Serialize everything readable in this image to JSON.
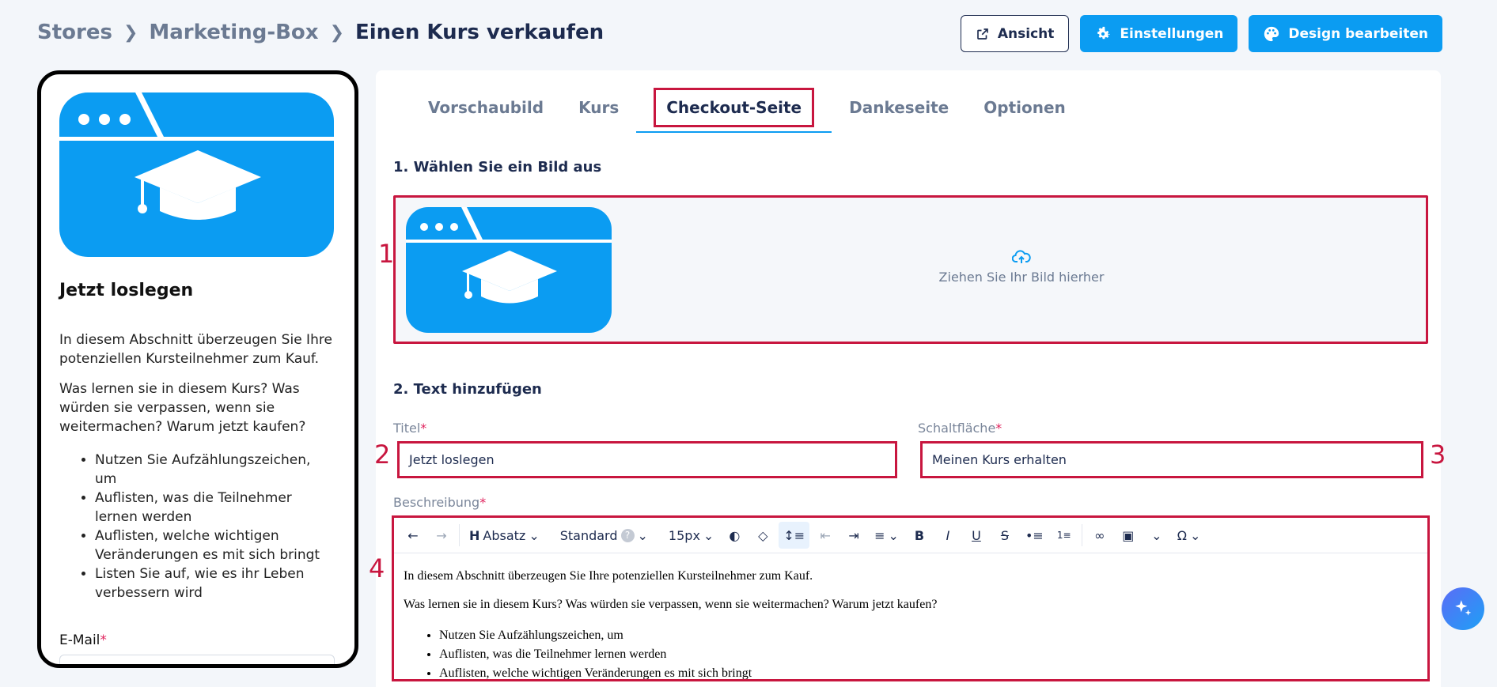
{
  "breadcrumb": {
    "items": [
      "Stores",
      "Marketing-Box",
      "Einen Kurs verkaufen"
    ],
    "separator": ">"
  },
  "actions": {
    "view_label": "Ansicht",
    "settings_label": "Einstellungen",
    "design_label": "Design bearbeiten"
  },
  "preview": {
    "title": "Jetzt loslegen",
    "paragraphs": [
      "In diesem Abschnitt überzeugen Sie Ihre potenziellen Kursteilnehmer zum Kauf.",
      "Was lernen sie in diesem Kurs? Was würden sie verpassen, wenn sie weitermachen? Warum jetzt kaufen?"
    ],
    "bullets": [
      "Nutzen Sie Aufzählungszeichen, um",
      "Auflisten, was die Teilnehmer lernen werden",
      "Auflisten, welche wichtigen Veränderungen es mit sich bringt",
      "Listen Sie auf, wie es ihr Leben verbessern wird"
    ],
    "email_label": "E-Mail",
    "required_mark": "*"
  },
  "tabs": [
    {
      "label": "Vorschaubild"
    },
    {
      "label": "Kurs"
    },
    {
      "label": "Checkout-Seite",
      "active": true
    },
    {
      "label": "Dankeseite"
    },
    {
      "label": "Optionen"
    }
  ],
  "section1": {
    "title": "1. Wählen Sie ein Bild aus",
    "drop_text": "Ziehen Sie Ihr Bild hierher"
  },
  "section2": {
    "title": "2. Text hinzufügen",
    "title_label": "Titel",
    "title_value": "Jetzt loslegen",
    "button_label": "Schaltfläche",
    "button_value": "Meinen Kurs erhalten",
    "description_label": "Beschreibung"
  },
  "editor": {
    "heading_select": "Absatz",
    "style_select": "Standard",
    "size_select": "15px",
    "body_paragraphs": [
      "In diesem Abschnitt überzeugen Sie Ihre potenziellen Kursteilnehmer zum Kauf.",
      "Was lernen sie in diesem Kurs? Was würden sie verpassen, wenn sie weitermachen? Warum jetzt kaufen?"
    ],
    "body_bullets": [
      "Nutzen Sie Aufzählungszeichen, um",
      "Auflisten, was die Teilnehmer lernen werden",
      "Auflisten, welche wichtigen Veränderungen es mit sich bringt"
    ]
  },
  "markers": [
    "1",
    "2",
    "3",
    "4"
  ],
  "colors": {
    "accent": "#0b9cf2",
    "highlight": "#c8163f",
    "text": "#1d2b4f",
    "muted": "#6b7a92",
    "background": "#f3f6fa"
  },
  "icons": [
    "external-link-icon",
    "gear-icon",
    "palette-icon",
    "upload-cloud-icon",
    "graduation-cap-icon",
    "ai-sparkle-icon"
  ]
}
